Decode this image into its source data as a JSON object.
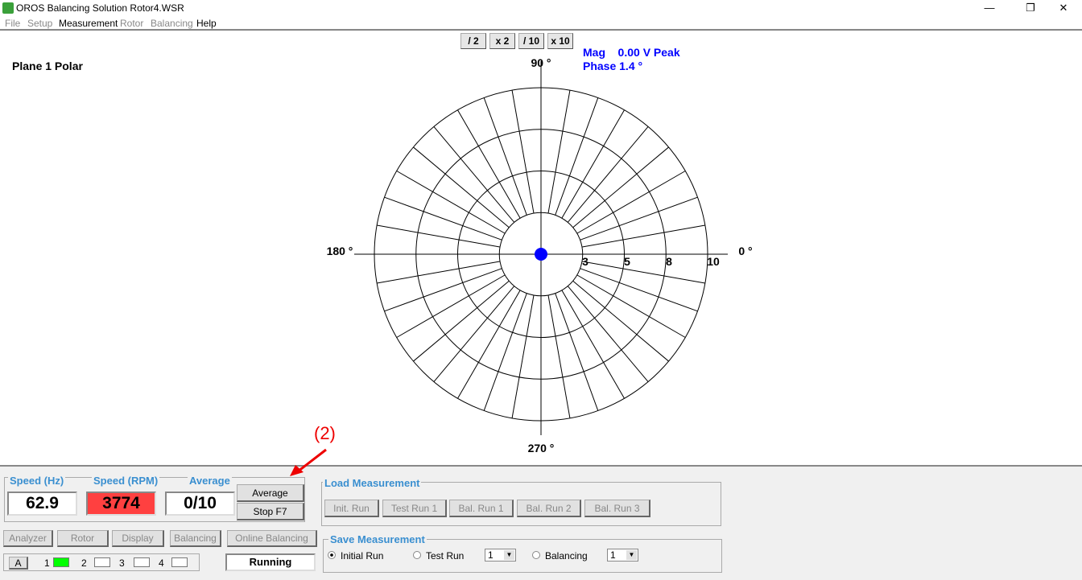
{
  "window": {
    "title": "OROS Balancing Solution Rotor4.WSR",
    "minimize": "—",
    "restore": "❐",
    "close": "✕"
  },
  "menu": [
    {
      "label": "File",
      "enabled": false
    },
    {
      "label": "Setup",
      "enabled": false
    },
    {
      "label": "Measurement",
      "enabled": true
    },
    {
      "label": "Rotor",
      "enabled": false
    },
    {
      "label": "Balancing",
      "enabled": false
    },
    {
      "label": "Help",
      "enabled": true
    }
  ],
  "scale_buttons": [
    "/ 2",
    "x 2",
    "/ 10",
    "x 10"
  ],
  "plot": {
    "title": "Plane 1  Polar",
    "mag": "Mag    0.00 V Peak",
    "phase": "Phase 1.4 °",
    "angles": {
      "a0": "0 °",
      "a90": "90 °",
      "a180": "180 °",
      "a270": "270 °"
    },
    "ring_labels": [
      "3",
      "5",
      "8",
      "10"
    ],
    "spoke_step_deg": 10,
    "point": {
      "magnitude": 0.0,
      "phase_deg": 1.4
    },
    "point_color": "#0000ff"
  },
  "speed": {
    "hz_label": "Speed (Hz)",
    "hz": "62.9",
    "rpm_label": "Speed (RPM)",
    "rpm": "3774",
    "rpm_color": "#ff4040",
    "avg_label": "Average",
    "avg": "0/10",
    "average_button": "Average",
    "stop_button": "Stop F7"
  },
  "nav_buttons": [
    "Analyzer",
    "Rotor",
    "Display",
    "Balancing",
    "Online Balancing"
  ],
  "channels": {
    "a_button": "A",
    "items": [
      {
        "label": "1",
        "active": true
      },
      {
        "label": "2",
        "active": false
      },
      {
        "label": "3",
        "active": false
      },
      {
        "label": "4",
        "active": false
      }
    ],
    "active_color": "#00ff00"
  },
  "status": "Running",
  "load": {
    "label": "Load Measurement",
    "buttons": [
      "Init. Run",
      "Test Run 1",
      "Bal. Run 1",
      "Bal. Run 2",
      "Bal. Run 3"
    ]
  },
  "save": {
    "label": "Save Measurement",
    "initial_run": "Initial Run",
    "test_run": "Test Run",
    "test_run_value": "1",
    "balancing": "Balancing",
    "balancing_value": "1",
    "selected": "Initial Run"
  },
  "annotation": {
    "label": "(2)"
  }
}
